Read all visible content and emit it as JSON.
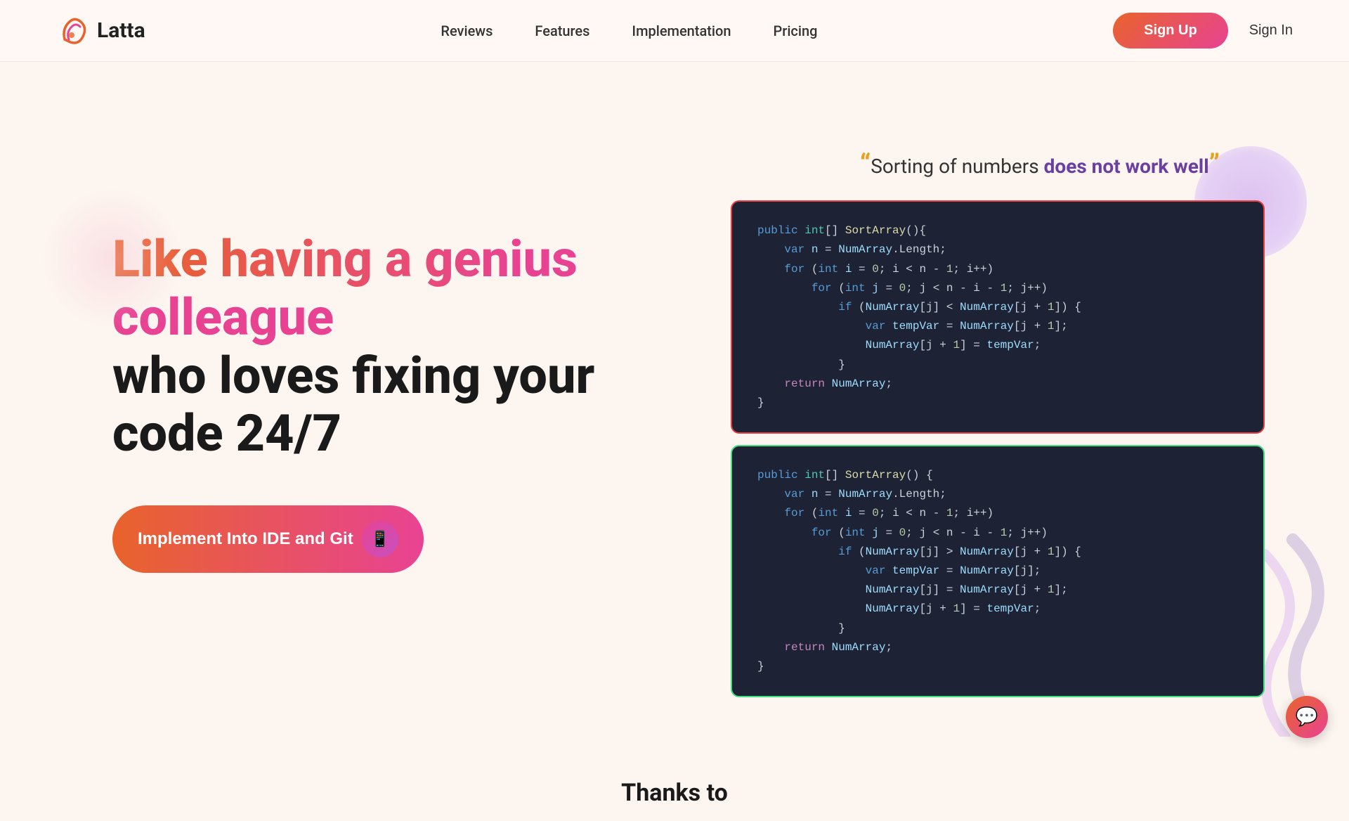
{
  "brand": {
    "name": "Latta",
    "logo_alt": "Latta logo"
  },
  "nav": {
    "links": [
      {
        "label": "Reviews",
        "href": "#"
      },
      {
        "label": "Features",
        "href": "#"
      },
      {
        "label": "Implementation",
        "href": "#"
      },
      {
        "label": "Pricing",
        "href": "#"
      }
    ],
    "signup_label": "Sign Up",
    "signin_label": "Sign In"
  },
  "hero": {
    "title_gradient": "Like having a genius colleague",
    "title_dark": "who loves fixing your code 24/7",
    "cta_label": "Implement Into IDE and Git",
    "quote_before": "Sorting of numbers ",
    "quote_highlight": "does not work well",
    "quote_marks_open": "“",
    "quote_marks_close": "”"
  },
  "code_card_1": {
    "lines": [
      "public int[] SortArray(){",
      "    var n = NumArray.Length;",
      "    for (int i = 0; i < n - 1; i++)",
      "        for (int j = 0; j < n - i - 1; j++)",
      "            if (NumArray[j] < NumArray[j + 1]) {",
      "                var tempVar = NumArray[j + 1];",
      "                NumArray[j + 1] = tempVar;",
      "            }",
      "    return NumArray;",
      "}"
    ]
  },
  "code_card_2": {
    "lines": [
      "public int[] SortArray() {",
      "    var n = NumArray.Length;",
      "    for (int i = 0; i < n - 1; i++)",
      "        for (int j = 0; j < n - i - 1; j++)",
      "            if (NumArray[j] > NumArray[j + 1]) {",
      "                var tempVar = NumArray[j];",
      "                NumArray[j] = NumArray[j + 1];",
      "                NumArray[j + 1] = tempVar;",
      "            }",
      "    return NumArray;",
      "}"
    ]
  },
  "footer": {
    "thanks_label": "Thanks to"
  },
  "chat": {
    "icon": "💬"
  }
}
